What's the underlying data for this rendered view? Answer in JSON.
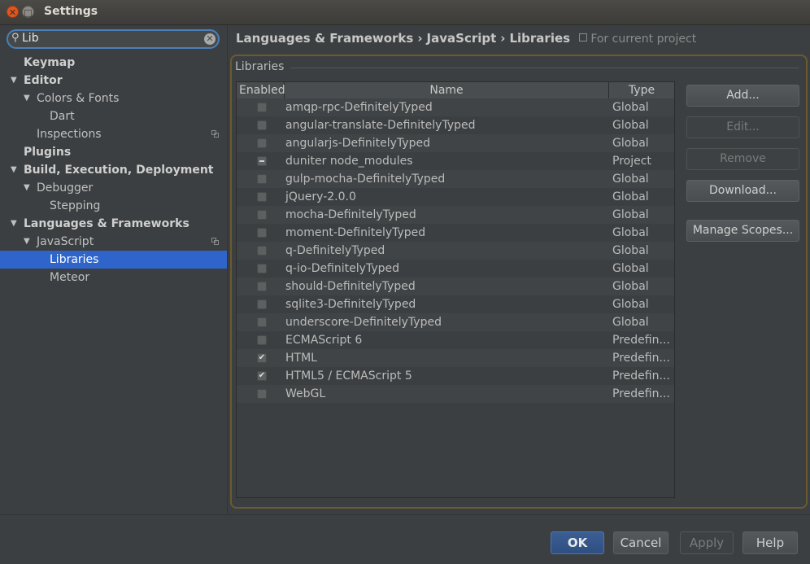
{
  "window": {
    "title": "Settings",
    "close_glyph": "✕",
    "max_glyph": "□"
  },
  "search": {
    "value": "Lib",
    "icon": "search-icon",
    "clear_glyph": "✕"
  },
  "tree": [
    {
      "label": "Keymap",
      "bold": true,
      "level": 0,
      "expanded": null,
      "selected": false,
      "project": false
    },
    {
      "label": "Editor",
      "bold": true,
      "level": 0,
      "expanded": true,
      "selected": false,
      "project": false
    },
    {
      "label": "Colors & Fonts",
      "bold": false,
      "level": 1,
      "expanded": true,
      "selected": false,
      "project": false
    },
    {
      "label": "Dart",
      "bold": false,
      "level": 2,
      "expanded": null,
      "selected": false,
      "project": false
    },
    {
      "label": "Inspections",
      "bold": false,
      "level": 1,
      "expanded": null,
      "selected": false,
      "project": true
    },
    {
      "label": "Plugins",
      "bold": true,
      "level": 0,
      "expanded": null,
      "selected": false,
      "project": false
    },
    {
      "label": "Build, Execution, Deployment",
      "bold": true,
      "level": 0,
      "expanded": true,
      "selected": false,
      "project": false
    },
    {
      "label": "Debugger",
      "bold": false,
      "level": 1,
      "expanded": true,
      "selected": false,
      "project": false
    },
    {
      "label": "Stepping",
      "bold": false,
      "level": 2,
      "expanded": null,
      "selected": false,
      "project": false
    },
    {
      "label": "Languages & Frameworks",
      "bold": true,
      "level": 0,
      "expanded": true,
      "selected": false,
      "project": false
    },
    {
      "label": "JavaScript",
      "bold": false,
      "level": 1,
      "expanded": true,
      "selected": false,
      "project": true
    },
    {
      "label": "Libraries",
      "bold": false,
      "level": 2,
      "expanded": null,
      "selected": true,
      "project": false
    },
    {
      "label": "Meteor",
      "bold": false,
      "level": 2,
      "expanded": null,
      "selected": false,
      "project": false
    }
  ],
  "breadcrumb": {
    "items": [
      "Languages & Frameworks",
      "JavaScript",
      "Libraries"
    ],
    "separator": "›",
    "scope_note": "For current project"
  },
  "libraries": {
    "group_label": "Libraries",
    "columns": {
      "enabled": "Enabled",
      "name": "Name",
      "type": "Type"
    },
    "rows": [
      {
        "name": "amqp-rpc-DefinitelyTyped",
        "type": "Global",
        "state": "unchecked"
      },
      {
        "name": "angular-translate-DefinitelyTyped",
        "type": "Global",
        "state": "unchecked"
      },
      {
        "name": "angularjs-DefinitelyTyped",
        "type": "Global",
        "state": "unchecked"
      },
      {
        "name": "duniter node_modules",
        "type": "Project",
        "state": "partial"
      },
      {
        "name": "gulp-mocha-DefinitelyTyped",
        "type": "Global",
        "state": "unchecked"
      },
      {
        "name": "jQuery-2.0.0",
        "type": "Global",
        "state": "unchecked"
      },
      {
        "name": "mocha-DefinitelyTyped",
        "type": "Global",
        "state": "unchecked"
      },
      {
        "name": "moment-DefinitelyTyped",
        "type": "Global",
        "state": "unchecked"
      },
      {
        "name": "q-DefinitelyTyped",
        "type": "Global",
        "state": "unchecked"
      },
      {
        "name": "q-io-DefinitelyTyped",
        "type": "Global",
        "state": "unchecked"
      },
      {
        "name": "should-DefinitelyTyped",
        "type": "Global",
        "state": "unchecked"
      },
      {
        "name": "sqlite3-DefinitelyTyped",
        "type": "Global",
        "state": "unchecked"
      },
      {
        "name": "underscore-DefinitelyTyped",
        "type": "Global",
        "state": "unchecked"
      },
      {
        "name": "ECMAScript 6",
        "type": "Predefin...",
        "state": "unchecked"
      },
      {
        "name": "HTML",
        "type": "Predefin...",
        "state": "checked"
      },
      {
        "name": "HTML5 / ECMAScript 5",
        "type": "Predefin...",
        "state": "checked"
      },
      {
        "name": "WebGL",
        "type": "Predefin...",
        "state": "unchecked"
      }
    ],
    "buttons": [
      {
        "label": "Add...",
        "enabled": true
      },
      {
        "label": "Edit...",
        "enabled": false
      },
      {
        "label": "Remove",
        "enabled": false
      },
      {
        "label": "Download...",
        "enabled": true
      },
      {
        "label": "Manage Scopes...",
        "enabled": true
      }
    ]
  },
  "footer": {
    "ok": "OK",
    "cancel": "Cancel",
    "apply": "Apply",
    "help": "Help"
  },
  "colors": {
    "accent": "#2f65ca",
    "background": "#3c3f41",
    "group_border": "#6a5a2e"
  }
}
